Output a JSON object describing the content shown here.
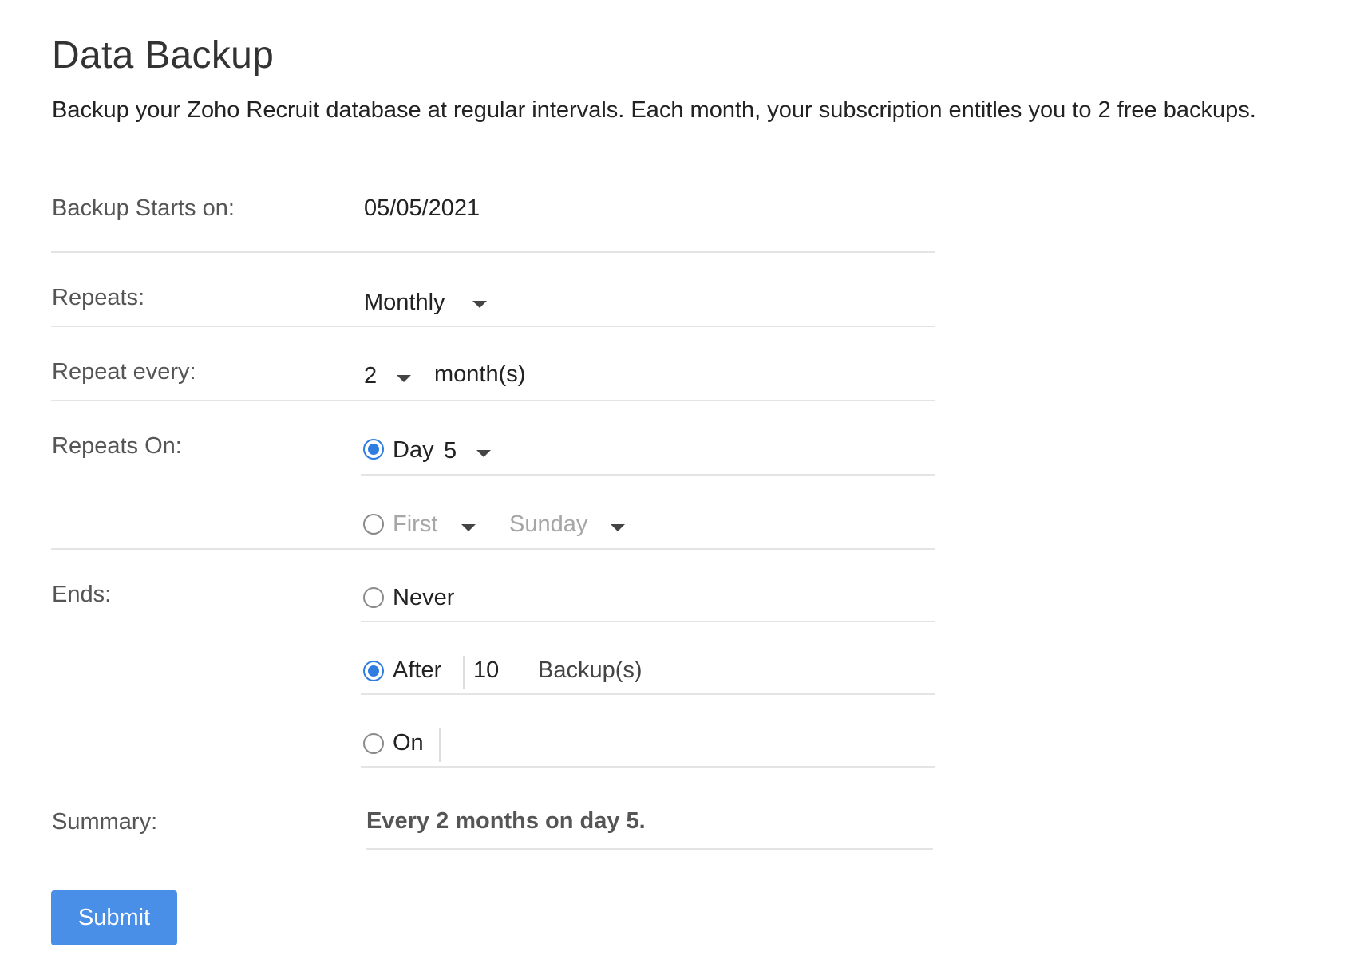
{
  "page": {
    "title": "Data Backup",
    "description": "Backup your Zoho Recruit database at regular intervals. Each month, your subscription entitles you to 2 free backups."
  },
  "form": {
    "start": {
      "label": "Backup Starts on:",
      "value": "05/05/2021"
    },
    "repeats": {
      "label": "Repeats:",
      "value": "Monthly",
      "icon": "chevron-down-icon"
    },
    "repeat_every": {
      "label": "Repeat every:",
      "value": "2",
      "unit": "month(s)",
      "icon": "chevron-down-icon"
    },
    "repeats_on": {
      "label": "Repeats On:",
      "day_option": {
        "label": "Day",
        "value": "5",
        "checked": true
      },
      "weekday_option": {
        "ordinal": "First",
        "weekday": "Sunday",
        "checked": false
      }
    },
    "ends": {
      "label": "Ends:",
      "never": {
        "label": "Never",
        "checked": false
      },
      "after": {
        "label": "After",
        "value": "10",
        "unit": "Backup(s)",
        "checked": true
      },
      "on": {
        "label": "On",
        "value": "",
        "checked": false
      }
    },
    "summary": {
      "label": "Summary:",
      "text": "Every 2 months on day 5."
    },
    "submit_label": "Submit"
  },
  "colors": {
    "accent": "#2f7de1",
    "button": "#4a8fe7",
    "divider": "#e4e4e4",
    "muted_text": "#a6a6a6"
  }
}
